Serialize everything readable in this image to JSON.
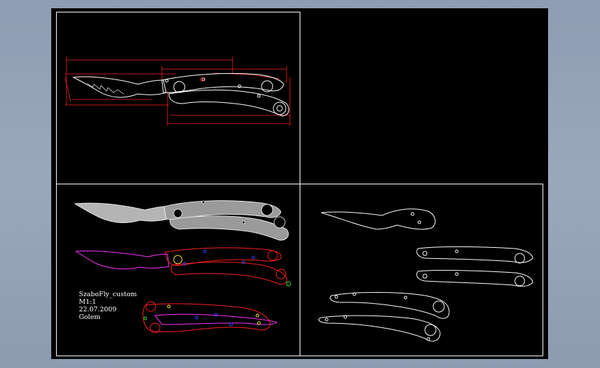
{
  "title_block": {
    "name": "SzaboFly_custom",
    "scale": "M1:1",
    "date": "22.07.2009",
    "author": "Golem"
  },
  "colors": {
    "background": "#000000",
    "frame": "#ffffff",
    "outline": "#ffffff",
    "dimension": "#ff2020",
    "blade_fill": "#b4b4b4",
    "handle_fill": "#9a9a9a",
    "magenta": "#ff33ff",
    "pin": "#3344ff",
    "screw": "#ffee33",
    "pivot": "#33ee33",
    "viewport_bg": "#8e9db3"
  }
}
